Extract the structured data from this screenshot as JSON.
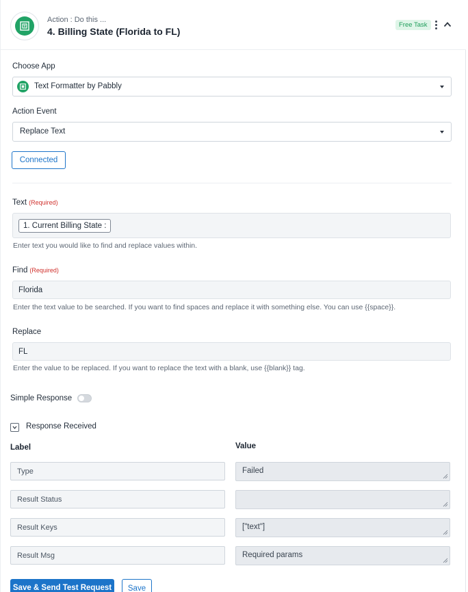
{
  "header": {
    "subtitle": "Action : Do this ...",
    "title": "4. Billing State (Florida to FL)",
    "badge": "Free Task",
    "app_icon": "text-formatter-icon"
  },
  "choose_app": {
    "label": "Choose App",
    "value": "Text Formatter by Pabbly"
  },
  "action_event": {
    "label": "Action Event",
    "value": "Replace Text"
  },
  "connected_button": "Connected",
  "fields": {
    "text": {
      "label": "Text",
      "required": "(Required)",
      "chip": "1. Current Billing State :",
      "help": "Enter text you would like to find and replace values within."
    },
    "find": {
      "label": "Find",
      "required": "(Required)",
      "value": "Florida",
      "help": "Enter the text value to be searched. If you want to find spaces and replace it with something else. You can use {{space}}."
    },
    "replace": {
      "label": "Replace",
      "value": "FL",
      "help": "Enter the value to be replaced. If you want to replace the text with a blank, use {{blank}} tag."
    }
  },
  "simple_response": {
    "label": "Simple Response",
    "enabled": false
  },
  "response": {
    "label": "Response Received",
    "label_header": "Label",
    "value_header": "Value",
    "rows": [
      {
        "label": "Type",
        "value": "Failed"
      },
      {
        "label": "Result Status",
        "value": ""
      },
      {
        "label": "Result Keys",
        "value": "[\"text\"]"
      },
      {
        "label": "Result Msg",
        "value": "Required params"
      }
    ]
  },
  "buttons": {
    "save_send": "Save & Send Test Request",
    "save": "Save"
  },
  "colors": {
    "primary": "#1c74c9",
    "app_green": "#21a366",
    "required_red": "#d0312d",
    "free_task_bg": "#dff5e8"
  }
}
